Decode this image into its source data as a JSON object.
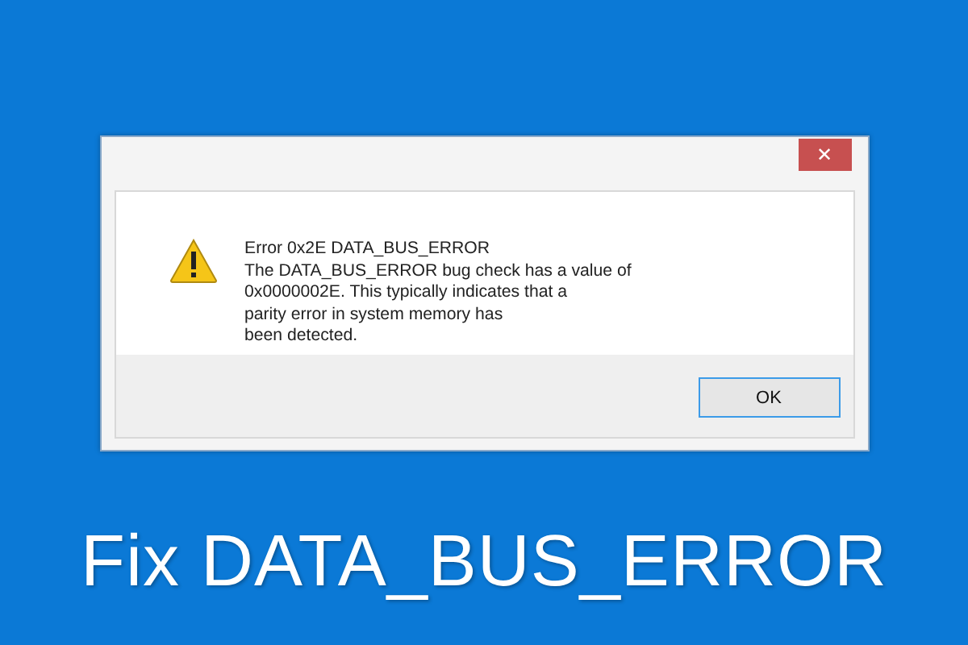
{
  "dialog": {
    "close_button": "✕",
    "title": "Error 0x2E DATA_BUS_ERROR",
    "message_lines": [
      "The DATA_BUS_ERROR bug check has a value of",
      "0x0000002E. This typically indicates that a",
      "parity error in system memory has",
      "been detected."
    ],
    "buttons": [
      {
        "label": "OK",
        "selected": true
      }
    ]
  },
  "headline": "Fix DATA_BUS_ERROR"
}
